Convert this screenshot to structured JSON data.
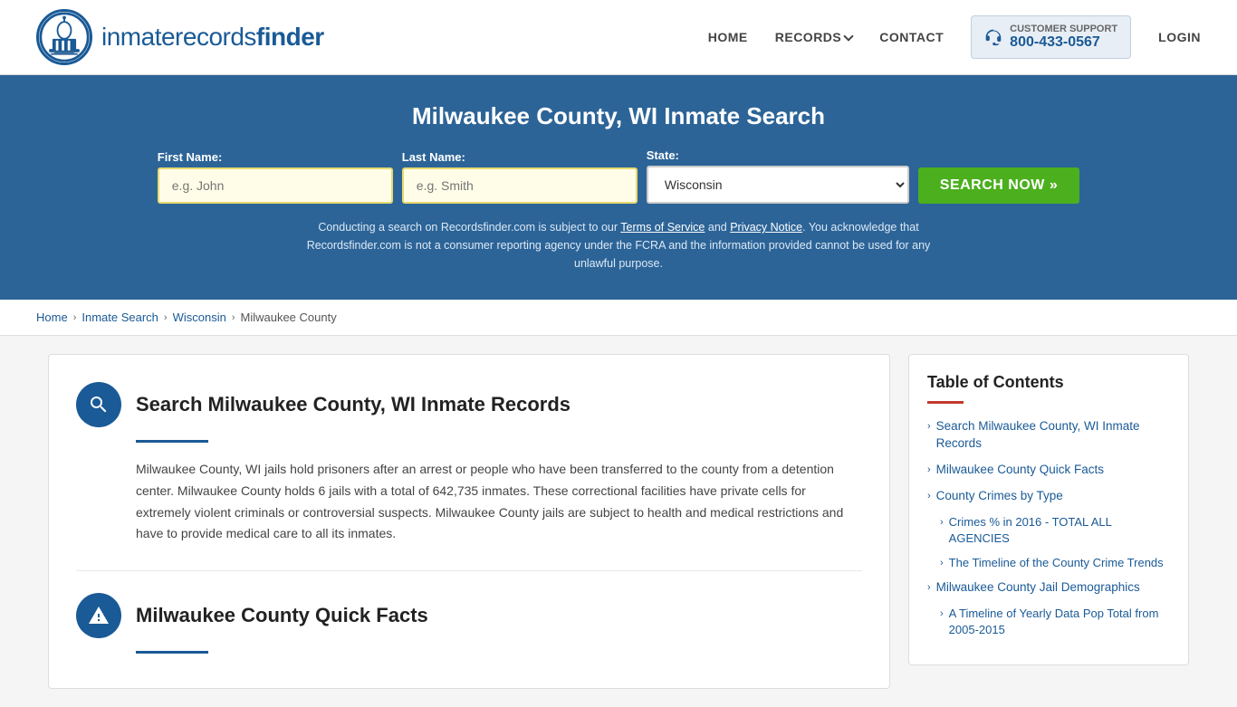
{
  "header": {
    "logo_text_main": "inmaterecords",
    "logo_text_bold": "finder",
    "nav": {
      "home": "HOME",
      "records": "RECORDS",
      "contact": "CONTACT",
      "support_label": "CUSTOMER SUPPORT",
      "support_number": "800-433-0567",
      "login": "LOGIN"
    }
  },
  "hero": {
    "title": "Milwaukee County, WI Inmate Search",
    "labels": {
      "first_name": "First Name:",
      "last_name": "Last Name:",
      "state": "State:"
    },
    "placeholders": {
      "first_name": "e.g. John",
      "last_name": "e.g. Smith"
    },
    "state_value": "Wisconsin",
    "search_button": "SEARCH NOW »",
    "disclaimer": "Conducting a search on Recordsfinder.com is subject to our Terms of Service and Privacy Notice. You acknowledge that Recordsfinder.com is not a consumer reporting agency under the FCRA and the information provided cannot be used for any unlawful purpose."
  },
  "breadcrumb": {
    "items": [
      "Home",
      "Inmate Search",
      "Wisconsin",
      "Milwaukee County"
    ]
  },
  "main": {
    "section1": {
      "title": "Search Milwaukee County, WI Inmate Records",
      "body": "Milwaukee County, WI jails hold prisoners after an arrest or people who have been transferred to the county from a detention center. Milwaukee County holds 6 jails with a total of 642,735 inmates. These correctional facilities have private cells for extremely violent criminals or controversial suspects. Milwaukee County jails are subject to health and medical restrictions and have to provide medical care to all its inmates."
    },
    "section2": {
      "title": "Milwaukee County Quick Facts"
    }
  },
  "toc": {
    "title": "Table of Contents",
    "items": [
      {
        "label": "Search Milwaukee County, WI Inmate Records",
        "sub": false
      },
      {
        "label": "Milwaukee County Quick Facts",
        "sub": false
      },
      {
        "label": "County Crimes by Type",
        "sub": false
      },
      {
        "label": "Crimes % in 2016 - TOTAL ALL AGENCIES",
        "sub": true
      },
      {
        "label": "The Timeline of the County Crime Trends",
        "sub": true
      },
      {
        "label": "Milwaukee County Jail Demographics",
        "sub": false
      },
      {
        "label": "A Timeline of Yearly Data Pop Total from 2005-2015",
        "sub": true
      }
    ]
  }
}
